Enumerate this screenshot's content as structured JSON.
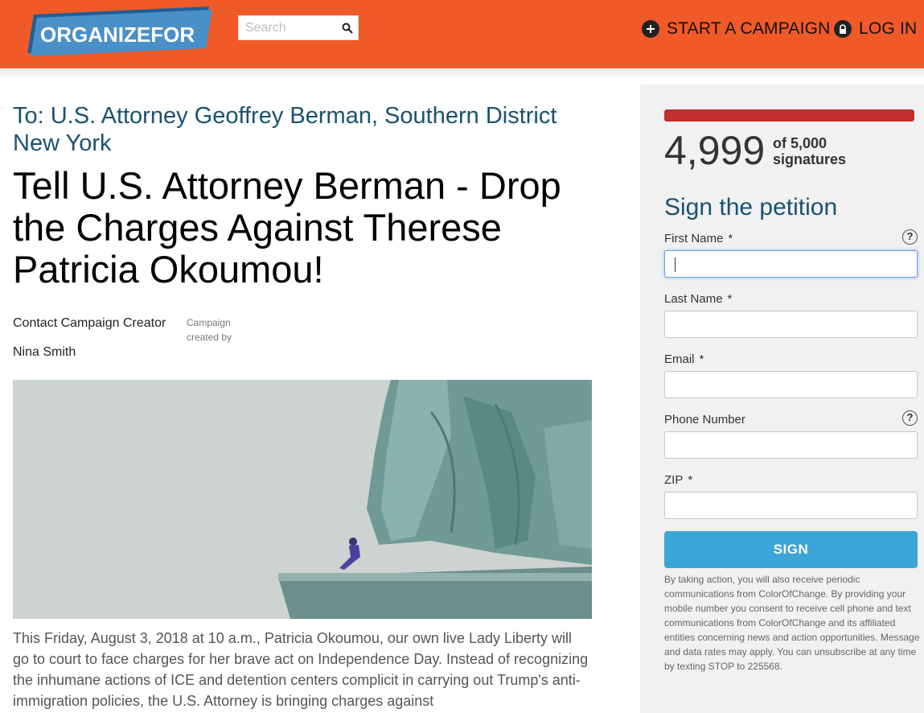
{
  "header": {
    "logo_text": "ORGANIZEFOR",
    "search_placeholder": "Search",
    "start_campaign": "START A CAMPAIGN",
    "log_in": "LOG IN",
    "colors": {
      "bar": "#f05a28",
      "logo_banner": "#4a90c8"
    }
  },
  "petition": {
    "to_line": "To: U.S. Attorney Geoffrey Berman, Southern District New York",
    "title": "Tell U.S. Attorney Berman - Drop the Charges Against Therese Patricia Okoumou!",
    "contact_label": "Contact Campaign Creator",
    "created_by_label": "Campaign created by",
    "creator_name": "Nina Smith",
    "body_text": "This Friday, August 3, 2018 at 10 a.m., Patricia Okoumou, our own live Lady Liberty will go to court to face charges for her brave act on Independence Day. Instead of recognizing the inhumane actions of ICE and detention centers complicit in carrying out Trump's anti-immigration policies, the U.S. Attorney is bringing charges against"
  },
  "signatures": {
    "count": "4,999",
    "of_goal": "of 5,000",
    "unit": "signatures",
    "progress_fraction": 0.9998,
    "bar_color": "#c0302c"
  },
  "form": {
    "heading": "Sign the petition",
    "fields": [
      {
        "label": "First Name",
        "required_mark": "*",
        "value": ""
      },
      {
        "label": "Last Name",
        "required_mark": "*",
        "value": ""
      },
      {
        "label": "Email",
        "required_mark": "*",
        "value": ""
      },
      {
        "label": "Phone Number",
        "required_mark": "",
        "value": ""
      },
      {
        "label": "ZIP",
        "required_mark": "*",
        "value": ""
      }
    ],
    "help_glyph": "?",
    "sign_button": "SIGN",
    "button_color": "#3aa5d6",
    "disclaimer": "By taking action, you will also receive periodic communications from ColorOfChange. By providing your mobile number you consent to receive cell phone and text communications from ColorOfChange and its affiliated entities concerning news and action opportunities. Message and data rates may apply. You can unsubscribe at any time by texting STOP to 225568."
  }
}
